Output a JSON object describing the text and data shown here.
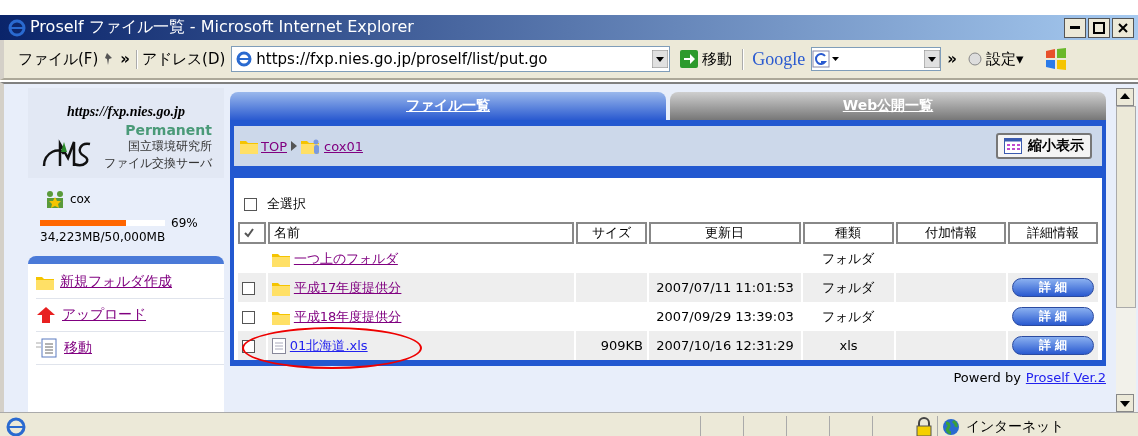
{
  "window": {
    "title": "Proself ファイル一覧 - Microsoft Internet Explorer"
  },
  "toolbar": {
    "menu": "ファイル(F)",
    "chevron": "»",
    "address_label": "アドレス(D)",
    "address": "https://fxp.nies.go.jp/proself/list/put.go",
    "go": "移動",
    "google": "Google",
    "google_chevron": "»",
    "settings": "設定▾"
  },
  "sidebar": {
    "site_url": "https://fxp.nies.go.jp",
    "logo_badge": "Permanent",
    "logo_line1": "国立環境研究所",
    "logo_line2": "ファイル交換サーバ",
    "user": "cox",
    "quota": {
      "percent": "69%",
      "level": 0.69,
      "text": "34,223MB/50,000MB"
    },
    "items": [
      {
        "kind": "folder",
        "label": "新規フォルダ作成"
      },
      {
        "kind": "upload",
        "label": "アップロード"
      },
      {
        "kind": "move",
        "label": "移動"
      }
    ]
  },
  "tabs": [
    {
      "label": "ファイル一覧",
      "selected": true
    },
    {
      "label": "Web公開一覧",
      "selected": false
    }
  ],
  "breadcrumb": [
    {
      "kind": "folder",
      "label": "TOP"
    },
    {
      "kind": "user-folder",
      "label": "cox01"
    }
  ],
  "view_button": "縮小表示",
  "select_all": {
    "label": "全選択",
    "checked": false
  },
  "table": {
    "columns": [
      "名前",
      "サイズ",
      "更新日",
      "種類",
      "付加情報",
      "詳細情報"
    ],
    "rows": [
      {
        "kind": "parent",
        "name": "一つ上のフォルダ",
        "visited": true,
        "size": "",
        "date": "",
        "type": "フォルダ",
        "detail": "",
        "circled": false
      },
      {
        "kind": "folder",
        "checked": false,
        "name": "平成17年度提供分",
        "visited": true,
        "size": "",
        "date": "2007/07/11 11:01:53",
        "type": "フォルダ",
        "detail": "詳 細",
        "circled": false
      },
      {
        "kind": "folder",
        "checked": false,
        "name": "平成18年度提供分",
        "visited": true,
        "size": "",
        "date": "2007/09/29 13:39:03",
        "type": "フォルダ",
        "detail": "詳 細",
        "circled": false
      },
      {
        "kind": "file",
        "checked": false,
        "name": "01北海道.xls",
        "visited": false,
        "size": "909KB",
        "date": "2007/10/16 12:31:29",
        "type": "xls",
        "detail": "詳 細",
        "circled": true
      }
    ]
  },
  "footer": {
    "text": "Powerd by",
    "link": "Proself Ver.2"
  },
  "status_bar": {
    "zone": "インターネット"
  }
}
